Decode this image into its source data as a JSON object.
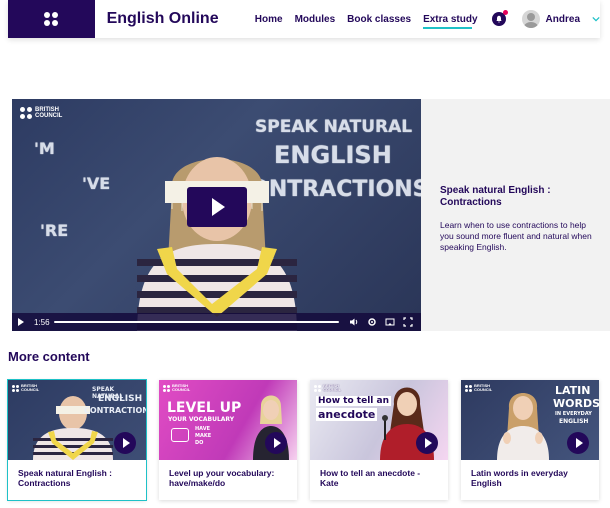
{
  "header": {
    "app_title": "English Online",
    "nav": [
      "Home",
      "Modules",
      "Book classes",
      "Extra study"
    ],
    "active_nav": "Extra study",
    "user_name": "Andrea",
    "notification": true
  },
  "hero": {
    "video": {
      "logo_line1": "BRITISH",
      "logo_line2": "COUNCIL",
      "chalk_line1": "SPEAK NATURAL",
      "chalk_line2": "ENGLISH",
      "chalk_line3": "CONTRACTIONS",
      "chalk_m": "'M",
      "chalk_ve": "'VE",
      "chalk_re": "'RE",
      "time": "1:56"
    },
    "title": "Speak natural English : Contractions",
    "description": "Learn when to use contractions to help you sound more fluent and natural when speaking English."
  },
  "more_content": {
    "heading": "More content",
    "cards": [
      {
        "title": "Speak natural English : Contractions",
        "thumb_text": [
          "SPEAK NATURAL",
          "ENGLISH",
          "CONTRACTIONS"
        ],
        "selected": true
      },
      {
        "title": "Level up your vocabulary: have/make/do",
        "thumb_text": [
          "LEVEL UP",
          "YOUR VOCABULARY",
          "HAVE",
          "MAKE",
          "DO"
        ],
        "selected": false
      },
      {
        "title": "How to tell an anecdote - Kate",
        "thumb_text": [
          "How to tell an",
          "anecdote"
        ],
        "selected": false
      },
      {
        "title": "Latin words in everyday English",
        "thumb_text": [
          "LATIN",
          "WORDS",
          "IN EVERYDAY",
          "ENGLISH"
        ],
        "selected": false
      }
    ]
  },
  "colors": {
    "brand": "#23085a",
    "accent": "#1ec1c7",
    "notification": "#e5005b"
  },
  "icons": [
    "logo-dots-icon",
    "bell-icon",
    "chevron-down-icon",
    "play-icon",
    "volume-icon",
    "settings-icon",
    "cast-icon",
    "fullscreen-icon"
  ]
}
